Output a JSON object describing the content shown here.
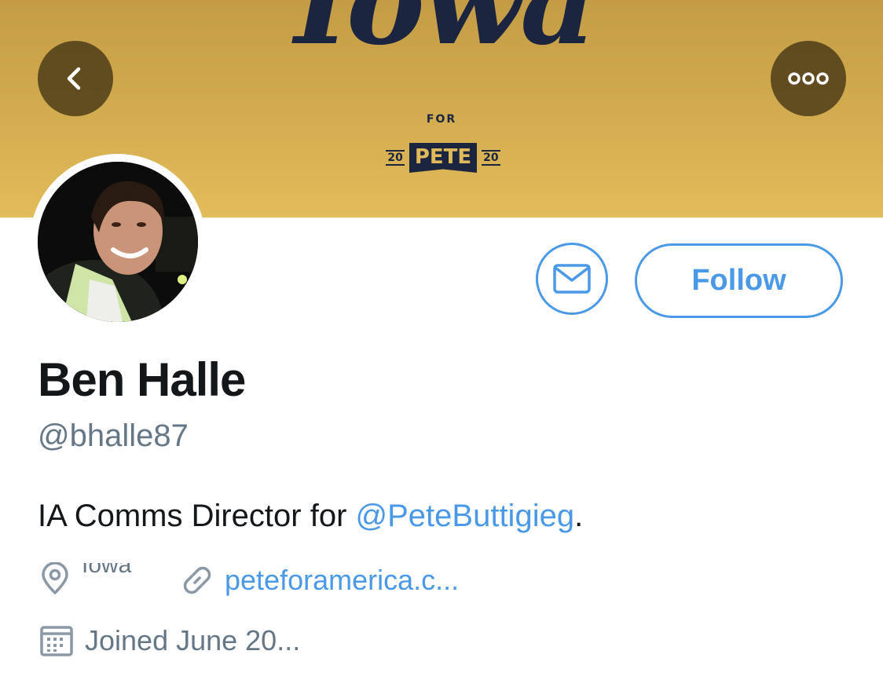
{
  "banner": {
    "script_text": "Iowa",
    "for_text": "FOR",
    "year_left": "20",
    "pete_text": "PETE",
    "year_right": "20"
  },
  "nav": {
    "back_icon": "chevron-left-icon",
    "more_icon": "ellipsis-icon"
  },
  "actions": {
    "message_icon": "envelope-icon",
    "follow_label": "Follow",
    "accent_color": "#4a99e9"
  },
  "profile": {
    "name": "Ben Halle",
    "handle": "@bhalle87",
    "bio_prefix": "IA Comms Director for ",
    "bio_mention": "@PeteButtigieg",
    "bio_suffix": ".",
    "location": "Iowa",
    "website": "peteforamerica.c...",
    "joined": "Joined June 20..."
  }
}
